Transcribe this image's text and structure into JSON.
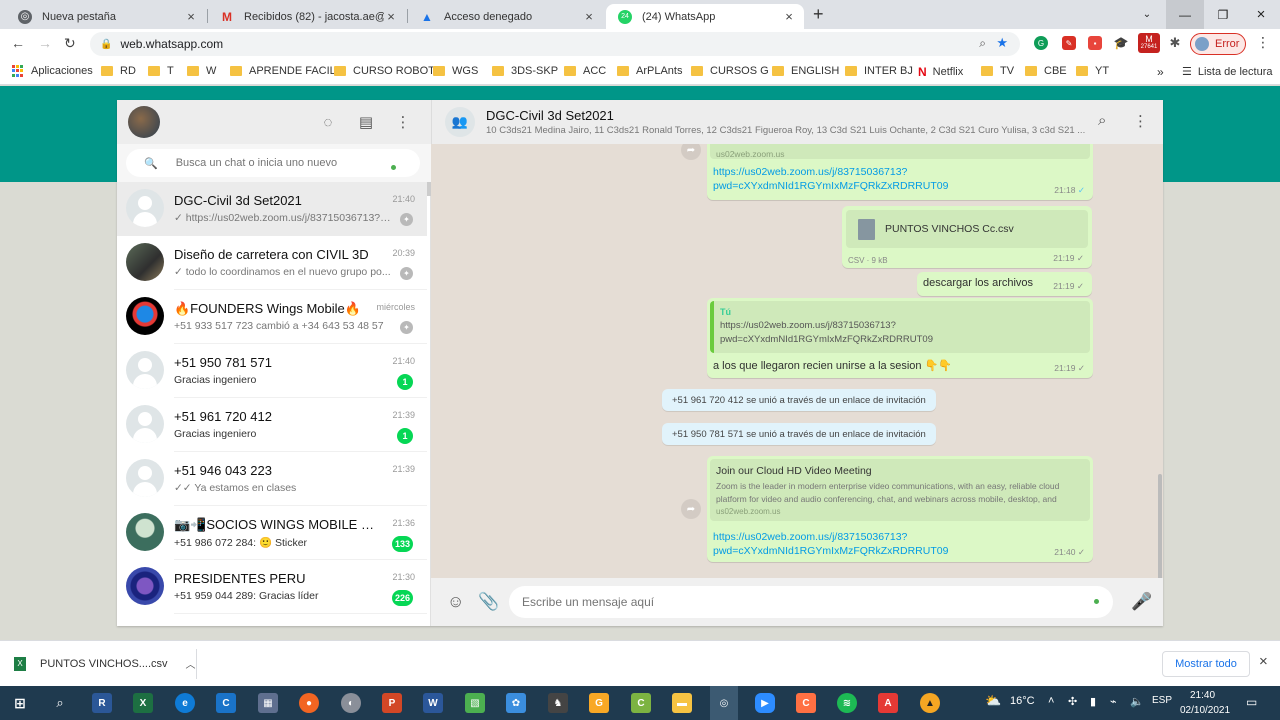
{
  "browser": {
    "tabs": [
      {
        "title": "Nueva pestaña"
      },
      {
        "title": "Recibidos (82) - jacosta.ae@gma"
      },
      {
        "title": "Acceso denegado"
      },
      {
        "title": "(24) WhatsApp",
        "badge": "24"
      }
    ],
    "url": "web.whatsapp.com",
    "error_label": "Error",
    "ext_badge": "27641",
    "bookmarks": [
      "Aplicaciones",
      "RD",
      "T",
      "W",
      "APRENDE FACIL",
      "CURSO ROBOT",
      "WGS",
      "3DS-SKP",
      "ACC",
      "ArPLAnts",
      "CURSOS G",
      "ENGLISH",
      "INTER BJ",
      "Netflix",
      "TV",
      "CBE",
      "YT"
    ],
    "more_label": "»",
    "reading_list": "Lista de lectura"
  },
  "sidebar": {
    "search_placeholder": "Busca un chat o inicia uno nuevo",
    "chats": [
      {
        "name": "DGC-Civil 3d Set2021",
        "time": "21:40",
        "preview": "https://us02web.zoom.us/j/83715036713?p...",
        "tick": "✓"
      },
      {
        "name": "Diseño de carretera con CIVIL 3D",
        "time": "20:39",
        "preview": "todo lo coordinamos en el nuevo grupo po...",
        "tick": "✓"
      },
      {
        "name": "🔥FOUNDERS Wings Mobile🔥",
        "time": "miércoles",
        "preview": "+51 933 517 723 cambió a +34 643 53 48 57"
      },
      {
        "name": "+51 950 781 571",
        "time": "21:40",
        "preview": "Gracias ingeniero",
        "badge": "1"
      },
      {
        "name": "+51 961 720 412",
        "time": "21:39",
        "preview": "Gracias ingeniero",
        "badge": "1"
      },
      {
        "name": "+51 946 043 223",
        "time": "21:39",
        "preview": "Ya estamos en clases",
        "tick": "✓✓"
      },
      {
        "name": "📷📲SOCIOS WINGS MOBILE 📲📷",
        "time": "21:36",
        "preview": "+51 986 072 284: 🙂 Sticker",
        "badge": "133"
      },
      {
        "name": "PRESIDENTES PERU",
        "time": "21:30",
        "preview": "+51 959 044 289: Gracias líder",
        "badge": "226"
      }
    ]
  },
  "conversation": {
    "title": "DGC-Civil 3d Set2021",
    "subtitle": "10 C3ds21 Medina Jairo, 11 C3ds21 Ronald Torres, 12 C3ds21 Figueroa Roy, 13 C3d S21 Luis Ochante, 2 C3d S21 Curo Yulisa, 3 c3d S21 ...",
    "messages": {
      "m1_domain": "us02web.zoom.us",
      "m1_link_1": "https://us02web.zoom.us/j/83715036713?",
      "m1_link_2": "pwd=cXYxdmNId1RGYmIxMzFQRkZxRDRRUT09",
      "m1_time": "21:18",
      "m2_file": "PUNTOS VINCHOS Cc.csv",
      "m2_meta": "CSV · 9 kB",
      "m2_time": "21:19",
      "m3_text": "descargar los archivos",
      "m3_time": "21:19",
      "m4_quote_author": "Tú",
      "m4_quote_1": "https://us02web.zoom.us/j/83715036713?",
      "m4_quote_2": "pwd=cXYxdmNId1RGYmIxMzFQRkZxRDRRUT09",
      "m4_text": "a los que llegaron recien unirse a la sesion 👇👇",
      "m4_time": "21:19",
      "sys1": "+51 961 720 412 se unió a través de un enlace de invitación",
      "sys2": "+51 950 781 571 se unió a través de un enlace de invitación",
      "m5_title": "Join our Cloud HD Video Meeting",
      "m5_desc_1": "Zoom is the leader in modern enterprise video communications, with an easy, reliable cloud",
      "m5_desc_2": "platform for video and audio conferencing, chat, and webinars across mobile, desktop, and",
      "m5_domain": "us02web.zoom.us",
      "m5_link_1": "https://us02web.zoom.us/j/83715036713?",
      "m5_link_2": "pwd=cXYxdmNId1RGYmIxMzFQRkZxRDRRUT09",
      "m5_time": "21:40"
    },
    "composer_placeholder": "Escribe un mensaje aquí"
  },
  "download": {
    "file": "PUNTOS VINCHOS....csv",
    "show_all": "Mostrar todo"
  },
  "taskbar": {
    "temperature": "16°C",
    "language": "ESP",
    "time": "21:40",
    "date": "02/10/2021"
  }
}
